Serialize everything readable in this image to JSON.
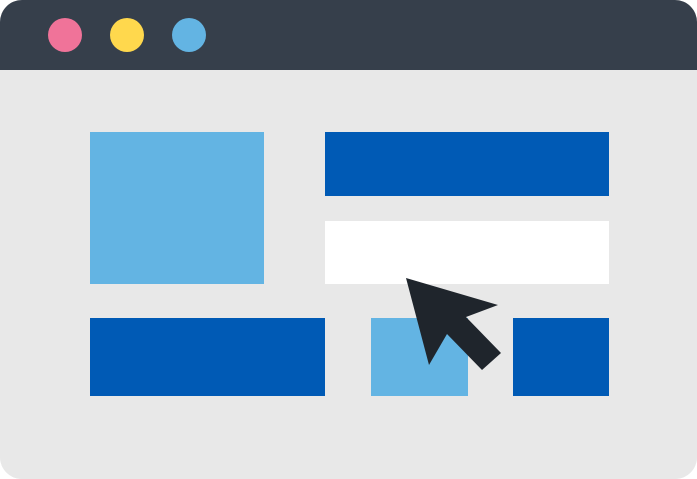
{
  "window": {
    "title": "",
    "controls": [
      {
        "name": "close",
        "color": "#f07399"
      },
      {
        "name": "minimize",
        "color": "#ffd84d"
      },
      {
        "name": "maximize",
        "color": "#63b4e3"
      }
    ]
  },
  "theme": {
    "titlebar_bg": "#363f4b",
    "body_bg": "#e8e8e8",
    "light_blue": "#63b4e3",
    "dark_blue": "#005ab5",
    "white": "#ffffff",
    "cursor": "#1f252c"
  },
  "icons": {
    "cursor": "arrow-cursor-icon"
  },
  "layout_blocks": [
    {
      "name": "hero-image-placeholder",
      "color": "#63b4e3"
    },
    {
      "name": "header-bar-placeholder",
      "color": "#005ab5"
    },
    {
      "name": "input-field-placeholder",
      "color": "#ffffff"
    },
    {
      "name": "wide-card-placeholder",
      "color": "#005ab5"
    },
    {
      "name": "small-card-placeholder",
      "color": "#63b4e3"
    },
    {
      "name": "right-card-placeholder",
      "color": "#005ab5"
    }
  ]
}
